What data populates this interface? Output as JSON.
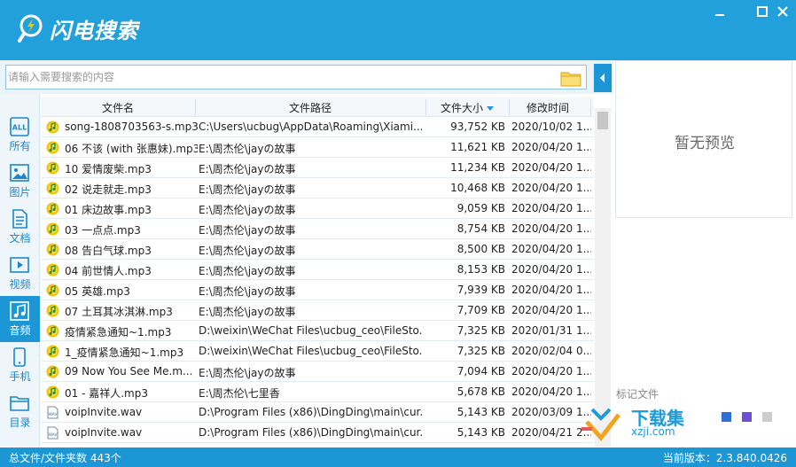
{
  "app": {
    "title": "闪电搜索"
  },
  "search": {
    "placeholder": "请输入需要搜索的内容"
  },
  "sidebar": {
    "items": [
      {
        "label": "所有",
        "icon": "all-icon",
        "active": false
      },
      {
        "label": "图片",
        "icon": "image-icon",
        "active": false
      },
      {
        "label": "文档",
        "icon": "document-icon",
        "active": false
      },
      {
        "label": "视频",
        "icon": "video-icon",
        "active": false
      },
      {
        "label": "音频",
        "icon": "music-icon",
        "active": true
      },
      {
        "label": "手机",
        "icon": "phone-icon",
        "active": false
      },
      {
        "label": "目录",
        "icon": "folder-icon",
        "active": false
      }
    ],
    "all_icon_text": "ALL"
  },
  "table": {
    "headers": {
      "name": "文件名",
      "path": "文件路径",
      "size": "文件大小",
      "date": "修改时间"
    },
    "rows": [
      {
        "name": "song-1808703563-s.mp3",
        "path": "C:\\Users\\ucbug\\AppData\\Roaming\\Xiami...",
        "size": "93,752 KB",
        "date": "2020/10/02 1...",
        "type": "audio"
      },
      {
        "name": "06 不该 (with 张惠妹).mp3",
        "path": "E:\\周杰伦\\jayの故事",
        "size": "11,621 KB",
        "date": "2020/04/20 1...",
        "type": "audio"
      },
      {
        "name": "10 爱情废柴.mp3",
        "path": "E:\\周杰伦\\jayの故事",
        "size": "11,234 KB",
        "date": "2020/04/20 1...",
        "type": "audio"
      },
      {
        "name": "02 说走就走.mp3",
        "path": "E:\\周杰伦\\jayの故事",
        "size": "10,468 KB",
        "date": "2020/04/20 1...",
        "type": "audio"
      },
      {
        "name": "01 床边故事.mp3",
        "path": "E:\\周杰伦\\jayの故事",
        "size": "9,059 KB",
        "date": "2020/04/20 1...",
        "type": "audio"
      },
      {
        "name": "03 一点点.mp3",
        "path": "E:\\周杰伦\\jayの故事",
        "size": "8,754 KB",
        "date": "2020/04/20 1...",
        "type": "audio"
      },
      {
        "name": "08 告白气球.mp3",
        "path": "E:\\周杰伦\\jayの故事",
        "size": "8,500 KB",
        "date": "2020/04/20 1...",
        "type": "audio"
      },
      {
        "name": "04 前世情人.mp3",
        "path": "E:\\周杰伦\\jayの故事",
        "size": "8,153 KB",
        "date": "2020/04/20 1...",
        "type": "audio"
      },
      {
        "name": "05 英雄.mp3",
        "path": "E:\\周杰伦\\jayの故事",
        "size": "7,939 KB",
        "date": "2020/04/20 1...",
        "type": "audio"
      },
      {
        "name": "07 土耳其冰淇淋.mp3",
        "path": "E:\\周杰伦\\jayの故事",
        "size": "7,709 KB",
        "date": "2020/04/20 1...",
        "type": "audio"
      },
      {
        "name": "疫情紧急通知~1.mp3",
        "path": "D:\\weixin\\WeChat Files\\ucbug_ceo\\FileSto...",
        "size": "7,325 KB",
        "date": "2020/01/31 1...",
        "type": "audio"
      },
      {
        "name": "1_疫情紧急通知~1.mp3",
        "path": "D:\\weixin\\WeChat Files\\ucbug_ceo\\FileSto...",
        "size": "7,325 KB",
        "date": "2020/02/04 0...",
        "type": "audio"
      },
      {
        "name": "09 Now You See Me.m...",
        "path": "E:\\周杰伦\\jayの故事",
        "size": "7,094 KB",
        "date": "2020/04/20 1...",
        "type": "audio"
      },
      {
        "name": "01 - 嘉祥人.mp3",
        "path": "E:\\周杰伦\\七里香",
        "size": "5,678 KB",
        "date": "2020/04/20 1...",
        "type": "audio"
      },
      {
        "name": "voipInvite.wav",
        "path": "D:\\Program Files (x86)\\DingDing\\main\\cur...",
        "size": "5,143 KB",
        "date": "2020/03/09 1...",
        "type": "wav"
      },
      {
        "name": "voipInvite.wav",
        "path": "D:\\Program Files (x86)\\DingDing\\main\\cur...",
        "size": "5,143 KB",
        "date": "2020/04/21 2...",
        "type": "wav"
      }
    ]
  },
  "preview": {
    "empty_text": "暂无预览",
    "mark_label": "标记文件"
  },
  "mark_colors": [
    "#2f6fd6",
    "#6c4fd8",
    "#b04cc7",
    "#cccccc"
  ],
  "status": {
    "total": "总文件/文件夹数 443个",
    "version": "当前版本：2.3.840.0426"
  },
  "watermark": {
    "brand": "下载集",
    "url": "xzji.com"
  },
  "colors": {
    "accent": "#1c96d4",
    "titlebar": "#22a0dc"
  }
}
